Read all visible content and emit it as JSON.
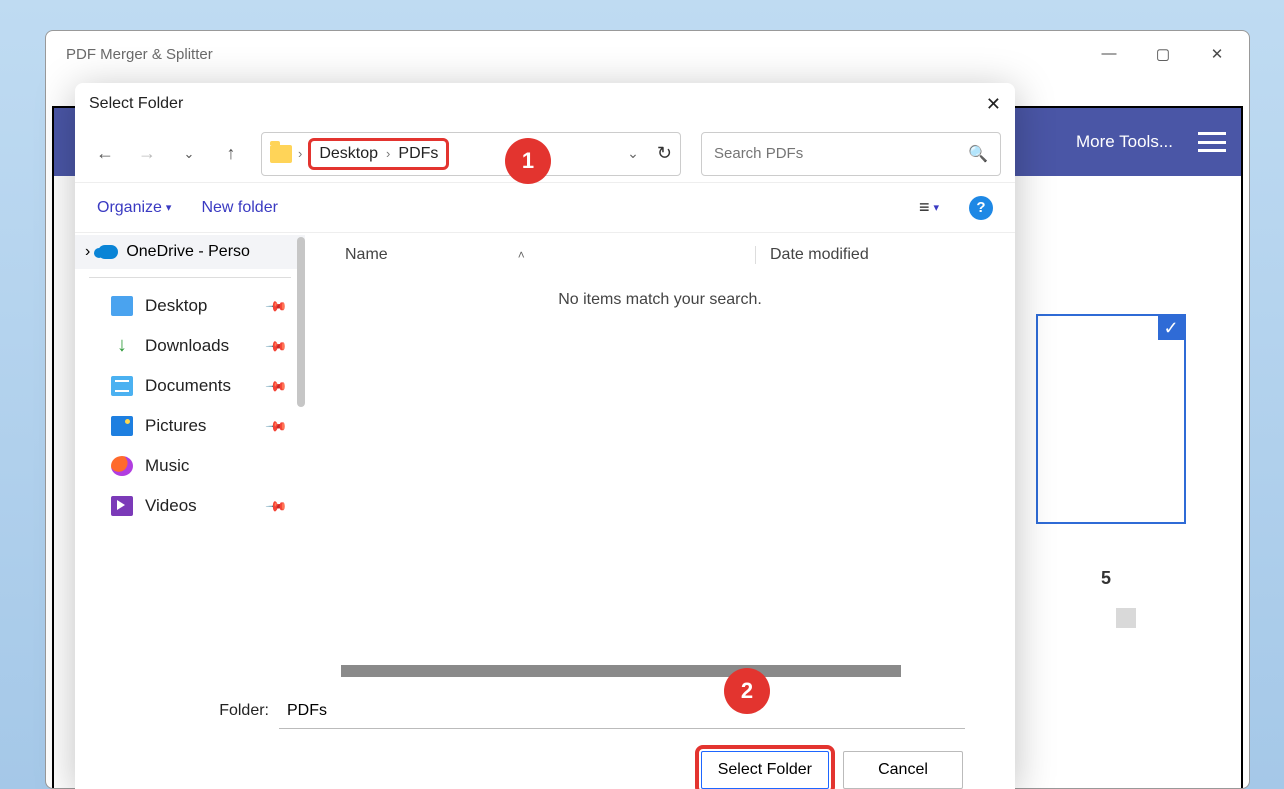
{
  "app": {
    "title": "PDF Merger & Splitter",
    "toolbar": {
      "more": "More Tools..."
    }
  },
  "thumb": {
    "label_suffix": "5"
  },
  "dialog": {
    "title": "Select Folder",
    "breadcrumb": {
      "part1": "Desktop",
      "part2": "PDFs"
    },
    "search": {
      "placeholder": "Search PDFs"
    },
    "tools": {
      "organize": "Organize",
      "newfolder": "New folder"
    },
    "sidebar": {
      "onedrive": "OneDrive - Perso",
      "items": [
        {
          "label": "Desktop"
        },
        {
          "label": "Downloads"
        },
        {
          "label": "Documents"
        },
        {
          "label": "Pictures"
        },
        {
          "label": "Music"
        },
        {
          "label": "Videos"
        }
      ]
    },
    "columns": {
      "name": "Name",
      "date": "Date modified"
    },
    "empty": "No items match your search.",
    "footer": {
      "label": "Folder:",
      "value": "PDFs",
      "select": "Select Folder",
      "cancel": "Cancel"
    }
  },
  "annotations": {
    "a1": "1",
    "a2": "2"
  }
}
